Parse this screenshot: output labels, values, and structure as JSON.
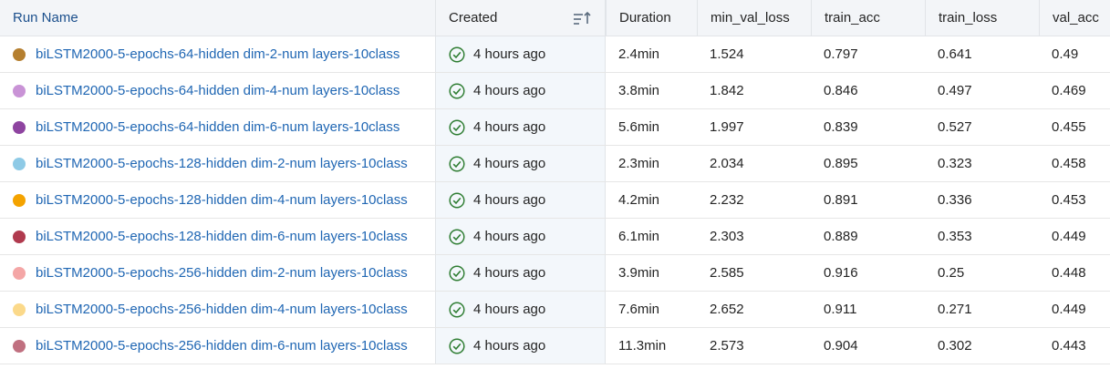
{
  "columns": {
    "run_name": "Run Name",
    "created": "Created",
    "duration": "Duration",
    "min_val_loss": "min_val_loss",
    "train_acc": "train_acc",
    "train_loss": "train_loss",
    "val_acc": "val_acc"
  },
  "colors": {
    "link": "#1f66b3",
    "status_ok": "#2e7d32"
  },
  "rows": [
    {
      "name": "biLSTM2000-5-epochs-64-hidden dim-2-num layers-10class",
      "color": "#b57f2f",
      "created": "4 hours ago",
      "duration": "2.4min",
      "min_val_loss": "1.524",
      "train_acc": "0.797",
      "train_loss": "0.641",
      "val_acc": "0.49"
    },
    {
      "name": "biLSTM2000-5-epochs-64-hidden dim-4-num layers-10class",
      "color": "#c993d6",
      "created": "4 hours ago",
      "duration": "3.8min",
      "min_val_loss": "1.842",
      "train_acc": "0.846",
      "train_loss": "0.497",
      "val_acc": "0.469"
    },
    {
      "name": "biLSTM2000-5-epochs-64-hidden dim-6-num layers-10class",
      "color": "#8e44a0",
      "created": "4 hours ago",
      "duration": "5.6min",
      "min_val_loss": "1.997",
      "train_acc": "0.839",
      "train_loss": "0.527",
      "val_acc": "0.455"
    },
    {
      "name": "biLSTM2000-5-epochs-128-hidden dim-2-num layers-10class",
      "color": "#8ecae6",
      "created": "4 hours ago",
      "duration": "2.3min",
      "min_val_loss": "2.034",
      "train_acc": "0.895",
      "train_loss": "0.323",
      "val_acc": "0.458"
    },
    {
      "name": "biLSTM2000-5-epochs-128-hidden dim-4-num layers-10class",
      "color": "#f4a300",
      "created": "4 hours ago",
      "duration": "4.2min",
      "min_val_loss": "2.232",
      "train_acc": "0.891",
      "train_loss": "0.336",
      "val_acc": "0.453"
    },
    {
      "name": "biLSTM2000-5-epochs-128-hidden dim-6-num layers-10class",
      "color": "#b03a4e",
      "created": "4 hours ago",
      "duration": "6.1min",
      "min_val_loss": "2.303",
      "train_acc": "0.889",
      "train_loss": "0.353",
      "val_acc": "0.449"
    },
    {
      "name": "biLSTM2000-5-epochs-256-hidden dim-2-num layers-10class",
      "color": "#f4a6a6",
      "created": "4 hours ago",
      "duration": "3.9min",
      "min_val_loss": "2.585",
      "train_acc": "0.916",
      "train_loss": "0.25",
      "val_acc": "0.448"
    },
    {
      "name": "biLSTM2000-5-epochs-256-hidden dim-4-num layers-10class",
      "color": "#fbd98a",
      "created": "4 hours ago",
      "duration": "7.6min",
      "min_val_loss": "2.652",
      "train_acc": "0.911",
      "train_loss": "0.271",
      "val_acc": "0.449"
    },
    {
      "name": "biLSTM2000-5-epochs-256-hidden dim-6-num layers-10class",
      "color": "#c07080",
      "created": "4 hours ago",
      "duration": "11.3min",
      "min_val_loss": "2.573",
      "train_acc": "0.904",
      "train_loss": "0.302",
      "val_acc": "0.443"
    }
  ]
}
